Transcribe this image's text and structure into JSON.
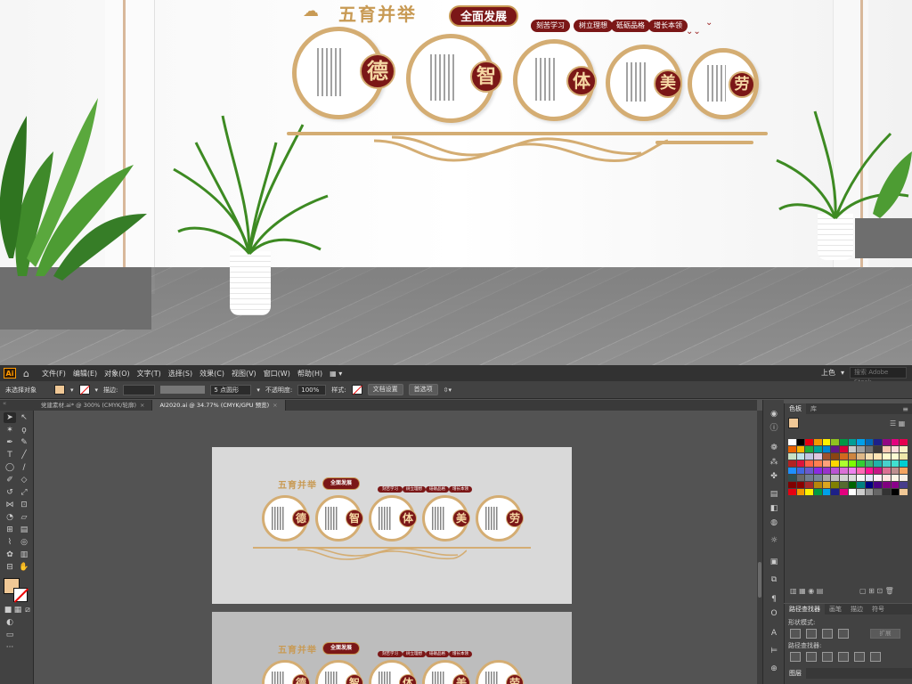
{
  "render": {
    "title": "五育并举",
    "subtitle": "全面发展",
    "tags": [
      "刻苦学习",
      "树立理想",
      "砥砺品格",
      "增长本领"
    ],
    "virtues": [
      "德",
      "智",
      "体",
      "美",
      "劳"
    ]
  },
  "menubar": {
    "logo": "Ai",
    "items": [
      "文件(F)",
      "编辑(E)",
      "对象(O)",
      "文字(T)",
      "选择(S)",
      "效果(C)",
      "视图(V)",
      "窗口(W)",
      "帮助(H)"
    ],
    "workspace": "上色",
    "search_placeholder": "搜索 Adobe Stock"
  },
  "control_bar": {
    "selection": "未选择对象",
    "stroke_label": "描边:",
    "brush_value": "5 点圆形",
    "opacity_label": "不透明度:",
    "opacity_value": "100%",
    "style_label": "样式:",
    "doc_setup": "文档设置",
    "preferences": "首选项"
  },
  "tabs": [
    {
      "label": "党建素材.ai* @ 300% (CMYK/轮廓)",
      "active": false
    },
    {
      "label": "AI2020.ai @ 34.77% (CMYK/GPU 预览)",
      "active": true
    }
  ],
  "artboard": {
    "title": "五育并举",
    "subtitle": "全面发展",
    "tags": [
      "刻苦学习",
      "树立理想",
      "砥砺品格",
      "增长本领"
    ],
    "virtues": [
      "德",
      "智",
      "体",
      "美",
      "劳"
    ]
  },
  "swatches_panel": {
    "tabs": [
      "色板",
      "库"
    ],
    "colors": [
      "#ffffff",
      "#000000",
      "#e60012",
      "#f39800",
      "#fff100",
      "#8fc31f",
      "#009944",
      "#009e96",
      "#00a0e9",
      "#0068b7",
      "#1d2088",
      "#920783",
      "#e4007f",
      "#e5004f",
      "#eb6100",
      "#f8b500",
      "#22ac38",
      "#00a29a",
      "#0086d1",
      "#601986",
      "#d7003a",
      "#c9caca",
      "#9fa0a0",
      "#727171",
      "#3e3a39",
      "#f7c9b2",
      "#fadbda",
      "#f9f2c7",
      "#c8e1c3",
      "#bfe2ea",
      "#c2c6e4",
      "#e0c7df",
      "#a0522d",
      "#8b4513",
      "#d2691e",
      "#cd853f",
      "#deb887",
      "#f5deb3",
      "#ffe4b5",
      "#fffacd",
      "#fafad2",
      "#eee8aa",
      "#b22222",
      "#dc143c",
      "#ff6347",
      "#ff7f50",
      "#ffa07a",
      "#ffd700",
      "#adff2f",
      "#7cfc00",
      "#32cd32",
      "#3cb371",
      "#20b2aa",
      "#48d1cc",
      "#40e0d0",
      "#00ced1",
      "#1e90ff",
      "#4169e1",
      "#6a5acd",
      "#8a2be2",
      "#9932cc",
      "#ba55d3",
      "#da70d6",
      "#ee82ee",
      "#ff69b4",
      "#ff1493",
      "#c71585",
      "#db7093",
      "#bc8f8f",
      "#f4a460",
      "#2f4f4f",
      "#696969",
      "#708090",
      "#778899",
      "#a9a9a9",
      "#c0c0c0",
      "#d3d3d3",
      "#dcdcdc",
      "#f5f5f5",
      "#e6e6fa",
      "#fff0f5",
      "#ffe4e1",
      "#fdf5e6",
      "#faf0e6",
      "#800000",
      "#8b0000",
      "#a52a2a",
      "#b8860b",
      "#daa520",
      "#808000",
      "#556b2f",
      "#006400",
      "#008080",
      "#000080",
      "#4b0082",
      "#800080",
      "#8b008b",
      "#483d8b",
      "#e60012",
      "#f39800",
      "#fff100",
      "#009944",
      "#00a0e9",
      "#1d2088",
      "#e4007f",
      "#ffffff",
      "#cccccc",
      "#999999",
      "#666666",
      "#333333",
      "#000000",
      "#f0c896"
    ]
  },
  "pathfinder_panel": {
    "tabs": [
      "路径查找器",
      "画笔",
      "描边",
      "符号"
    ],
    "shape_modes": "形状模式:",
    "expand": "扩展",
    "pathfinders": "路径查找器:"
  },
  "layers_panel": {
    "tabs": [
      "图层"
    ]
  }
}
